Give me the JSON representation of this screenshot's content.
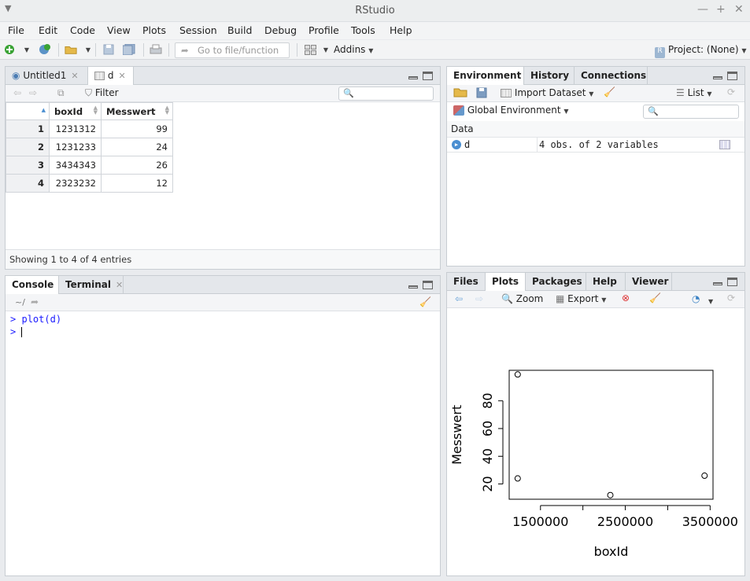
{
  "window": {
    "title": "RStudio"
  },
  "menu": [
    "File",
    "Edit",
    "Code",
    "View",
    "Plots",
    "Session",
    "Build",
    "Debug",
    "Profile",
    "Tools",
    "Help"
  ],
  "toolbar": {
    "goto_placeholder": "Go to file/function",
    "addins": "Addins",
    "project": "Project: (None)"
  },
  "source": {
    "tabs": [
      {
        "label": "Untitled1"
      },
      {
        "label": "d"
      }
    ],
    "filter": "Filter",
    "columns": [
      "boxId",
      "Messwert"
    ],
    "rows": [
      {
        "n": "1",
        "boxId": "1231312",
        "Messwert": "99"
      },
      {
        "n": "2",
        "boxId": "1231233",
        "Messwert": "24"
      },
      {
        "n": "3",
        "boxId": "3434343",
        "Messwert": "26"
      },
      {
        "n": "4",
        "boxId": "2323232",
        "Messwert": "12"
      }
    ],
    "status": "Showing 1 to 4 of 4 entries"
  },
  "console": {
    "tabs": [
      "Console",
      "Terminal"
    ],
    "path": "~/",
    "lines": [
      {
        "prompt": ">",
        "cmd": "plot(d)"
      },
      {
        "prompt": ">",
        "cmd": ""
      }
    ]
  },
  "environment": {
    "tabs": [
      "Environment",
      "History",
      "Connections"
    ],
    "import_label": "Import Dataset",
    "view_mode": "List",
    "scope": "Global Environment",
    "section": "Data",
    "objects": [
      {
        "name": "d",
        "value": "4 obs. of 2 variables"
      }
    ]
  },
  "files": {
    "tabs": [
      "Files",
      "Plots",
      "Packages",
      "Help",
      "Viewer"
    ],
    "zoom": "Zoom",
    "export": "Export"
  },
  "chart_data": {
    "type": "scatter",
    "xlabel": "boxId",
    "ylabel": "Messwert",
    "x": [
      1231312,
      1231233,
      3434343,
      2323232
    ],
    "y": [
      99,
      24,
      26,
      12
    ],
    "xlim": [
      1131000,
      3534000
    ],
    "ylim": [
      9,
      102
    ],
    "xticks": [
      1500000,
      2500000,
      3500000
    ],
    "xtick_labels": [
      "1500000",
      "2500000",
      "3500000"
    ],
    "xticks_minor": [
      2000000,
      3000000
    ],
    "yticks": [
      20,
      40,
      60,
      80
    ],
    "ytick_labels": [
      "20",
      "40",
      "60",
      "80"
    ],
    "marker_color": "#000000"
  }
}
